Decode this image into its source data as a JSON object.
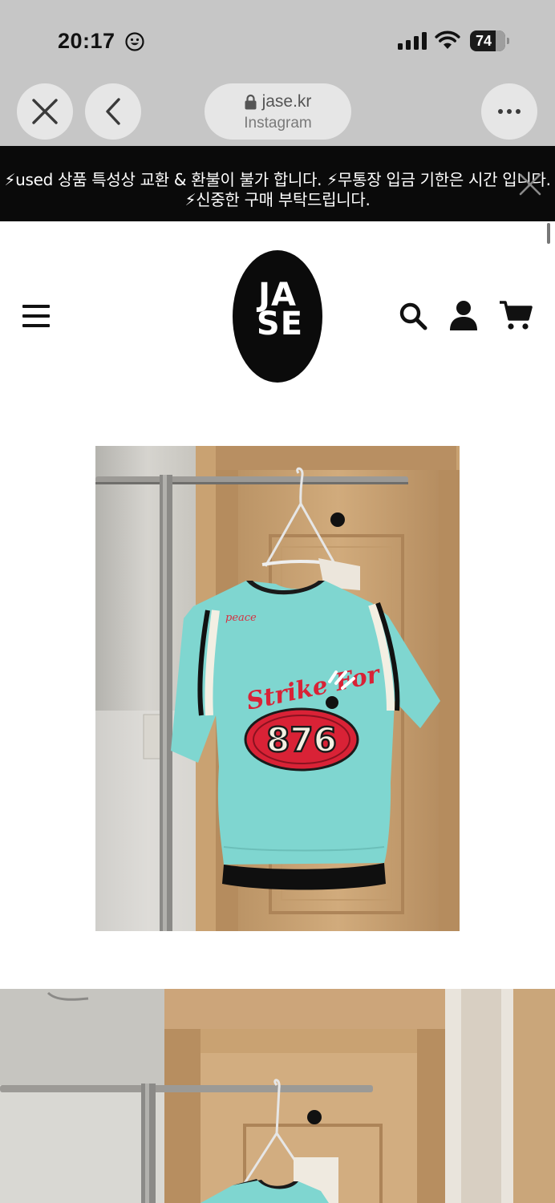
{
  "status_bar": {
    "time": "20:17",
    "battery_level": "74",
    "icons": [
      "smiley-icon",
      "signal-icon",
      "wifi-icon",
      "battery-icon"
    ]
  },
  "browser": {
    "domain": "jase.kr",
    "subtitle": "Instagram",
    "buttons": [
      "close-icon",
      "back-icon",
      "more-icon"
    ]
  },
  "announcement": {
    "text": "⚡used 상품 특성상 교환 & 환불이 불가 합니다. ⚡무통장 입금 기한은 시간 입니다. ⚡신중한 구매 부탁드립니다."
  },
  "header": {
    "logo_line1": "JA",
    "logo_line2": "SE",
    "icons": [
      "menu-icon",
      "search-icon",
      "account-icon",
      "cart-icon"
    ]
  },
  "product": {
    "garment_color": "#7fd6d0",
    "embroidery_script": "Strike For",
    "patch_number": "876",
    "chest_script": "peace"
  },
  "colors": {
    "chrome_bg": "#c6c6c6",
    "announcement_bg": "#0a0a0a",
    "patch_red": "#d92236"
  }
}
